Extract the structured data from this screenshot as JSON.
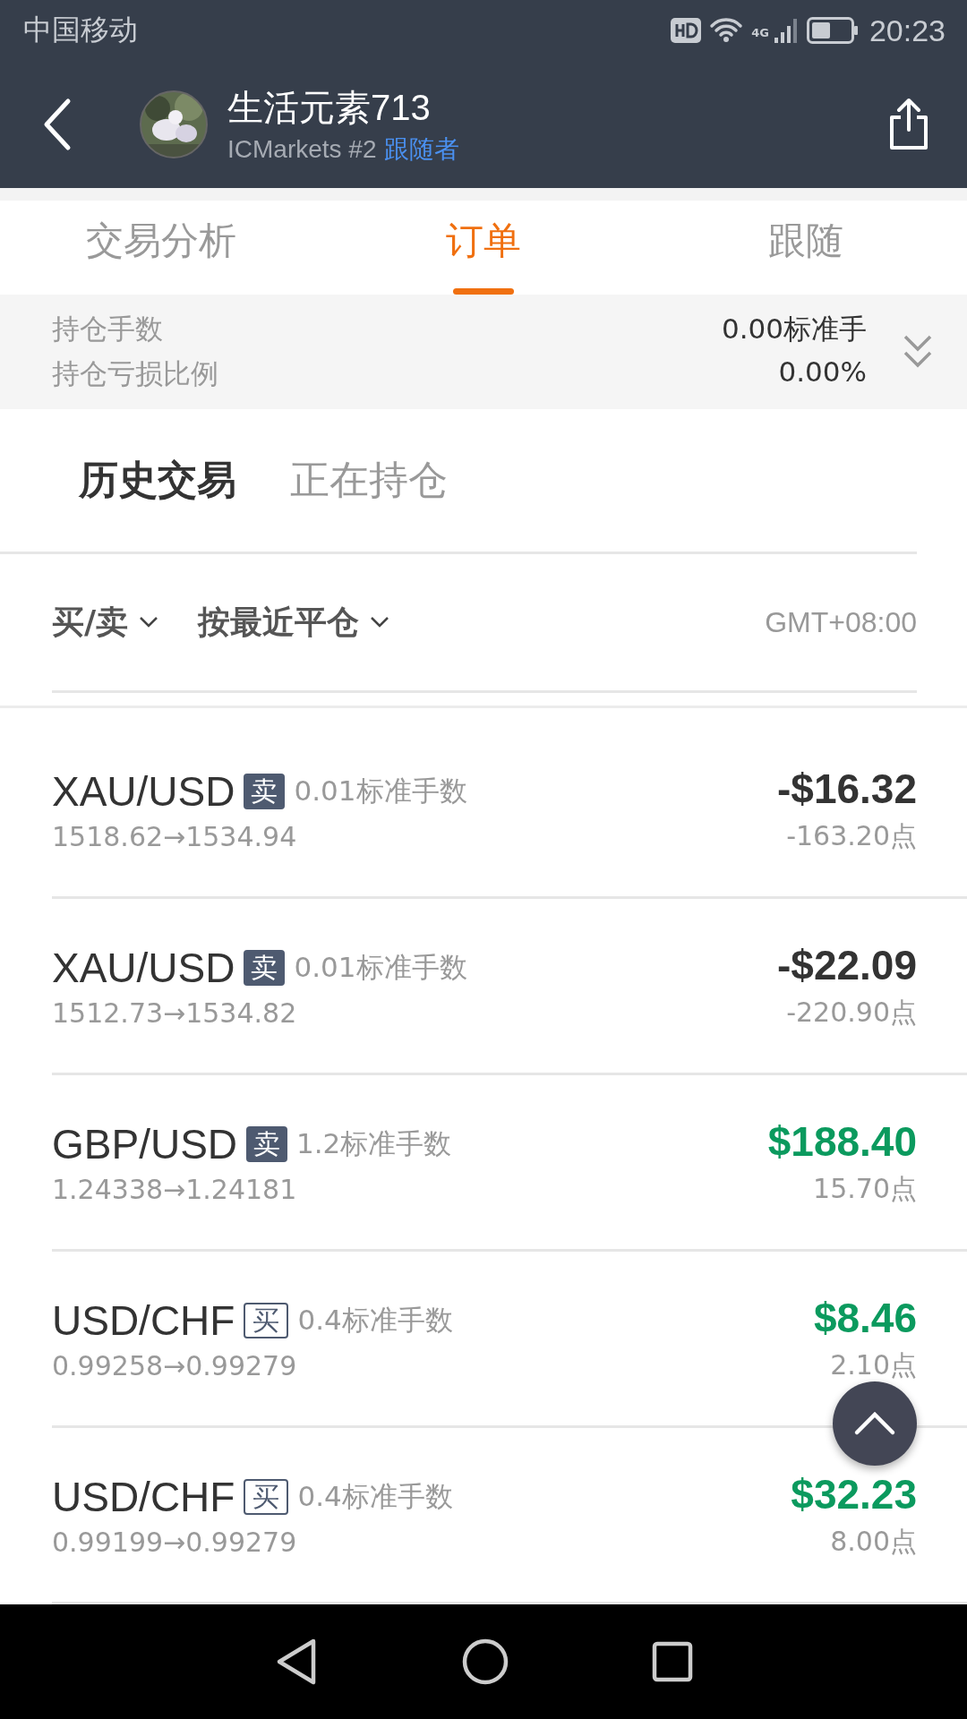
{
  "status_bar": {
    "carrier": "中国移动",
    "network": "4G",
    "time": "20:23"
  },
  "header": {
    "name": "生活元素713",
    "subtitle": "ICMarkets #2",
    "role": "跟随者"
  },
  "tabs": [
    {
      "label": "交易分析",
      "selected": false
    },
    {
      "label": "订单",
      "selected": true
    },
    {
      "label": "跟随",
      "selected": false
    }
  ],
  "summary": [
    {
      "label": "持仓手数",
      "value": "0.00标准手"
    },
    {
      "label": "持仓亏损比例",
      "value": "0.00%"
    }
  ],
  "subtabs": [
    {
      "label": "历史交易",
      "selected": true
    },
    {
      "label": "正在持仓",
      "selected": false
    }
  ],
  "filters": [
    {
      "label": "买/卖"
    },
    {
      "label": "按最近平仓"
    }
  ],
  "timezone": "GMT+08:00",
  "trades": [
    {
      "symbol": "XAU/USD",
      "sell": true,
      "side_label": "卖",
      "lots": "0.01标准手数",
      "prices": "1518.62→1534.94",
      "pnl": "-$16.32",
      "points": "-163.20点",
      "gain": false
    },
    {
      "symbol": "XAU/USD",
      "sell": true,
      "side_label": "卖",
      "lots": "0.01标准手数",
      "prices": "1512.73→1534.82",
      "pnl": "-$22.09",
      "points": "-220.90点",
      "gain": false
    },
    {
      "symbol": "GBP/USD",
      "sell": true,
      "side_label": "卖",
      "lots": "1.2标准手数",
      "prices": "1.24338→1.24181",
      "pnl": "$188.40",
      "points": "15.70点",
      "gain": true
    },
    {
      "symbol": "USD/CHF",
      "sell": false,
      "side_label": "买",
      "lots": "0.4标准手数",
      "prices": "0.99258→0.99279",
      "pnl": "$8.46",
      "points": "2.10点",
      "gain": true
    },
    {
      "symbol": "USD/CHF",
      "sell": false,
      "side_label": "买",
      "lots": "0.4标准手数",
      "prices": "0.99199→0.99279",
      "pnl": "$32.23",
      "points": "8.00点",
      "gain": true
    }
  ]
}
